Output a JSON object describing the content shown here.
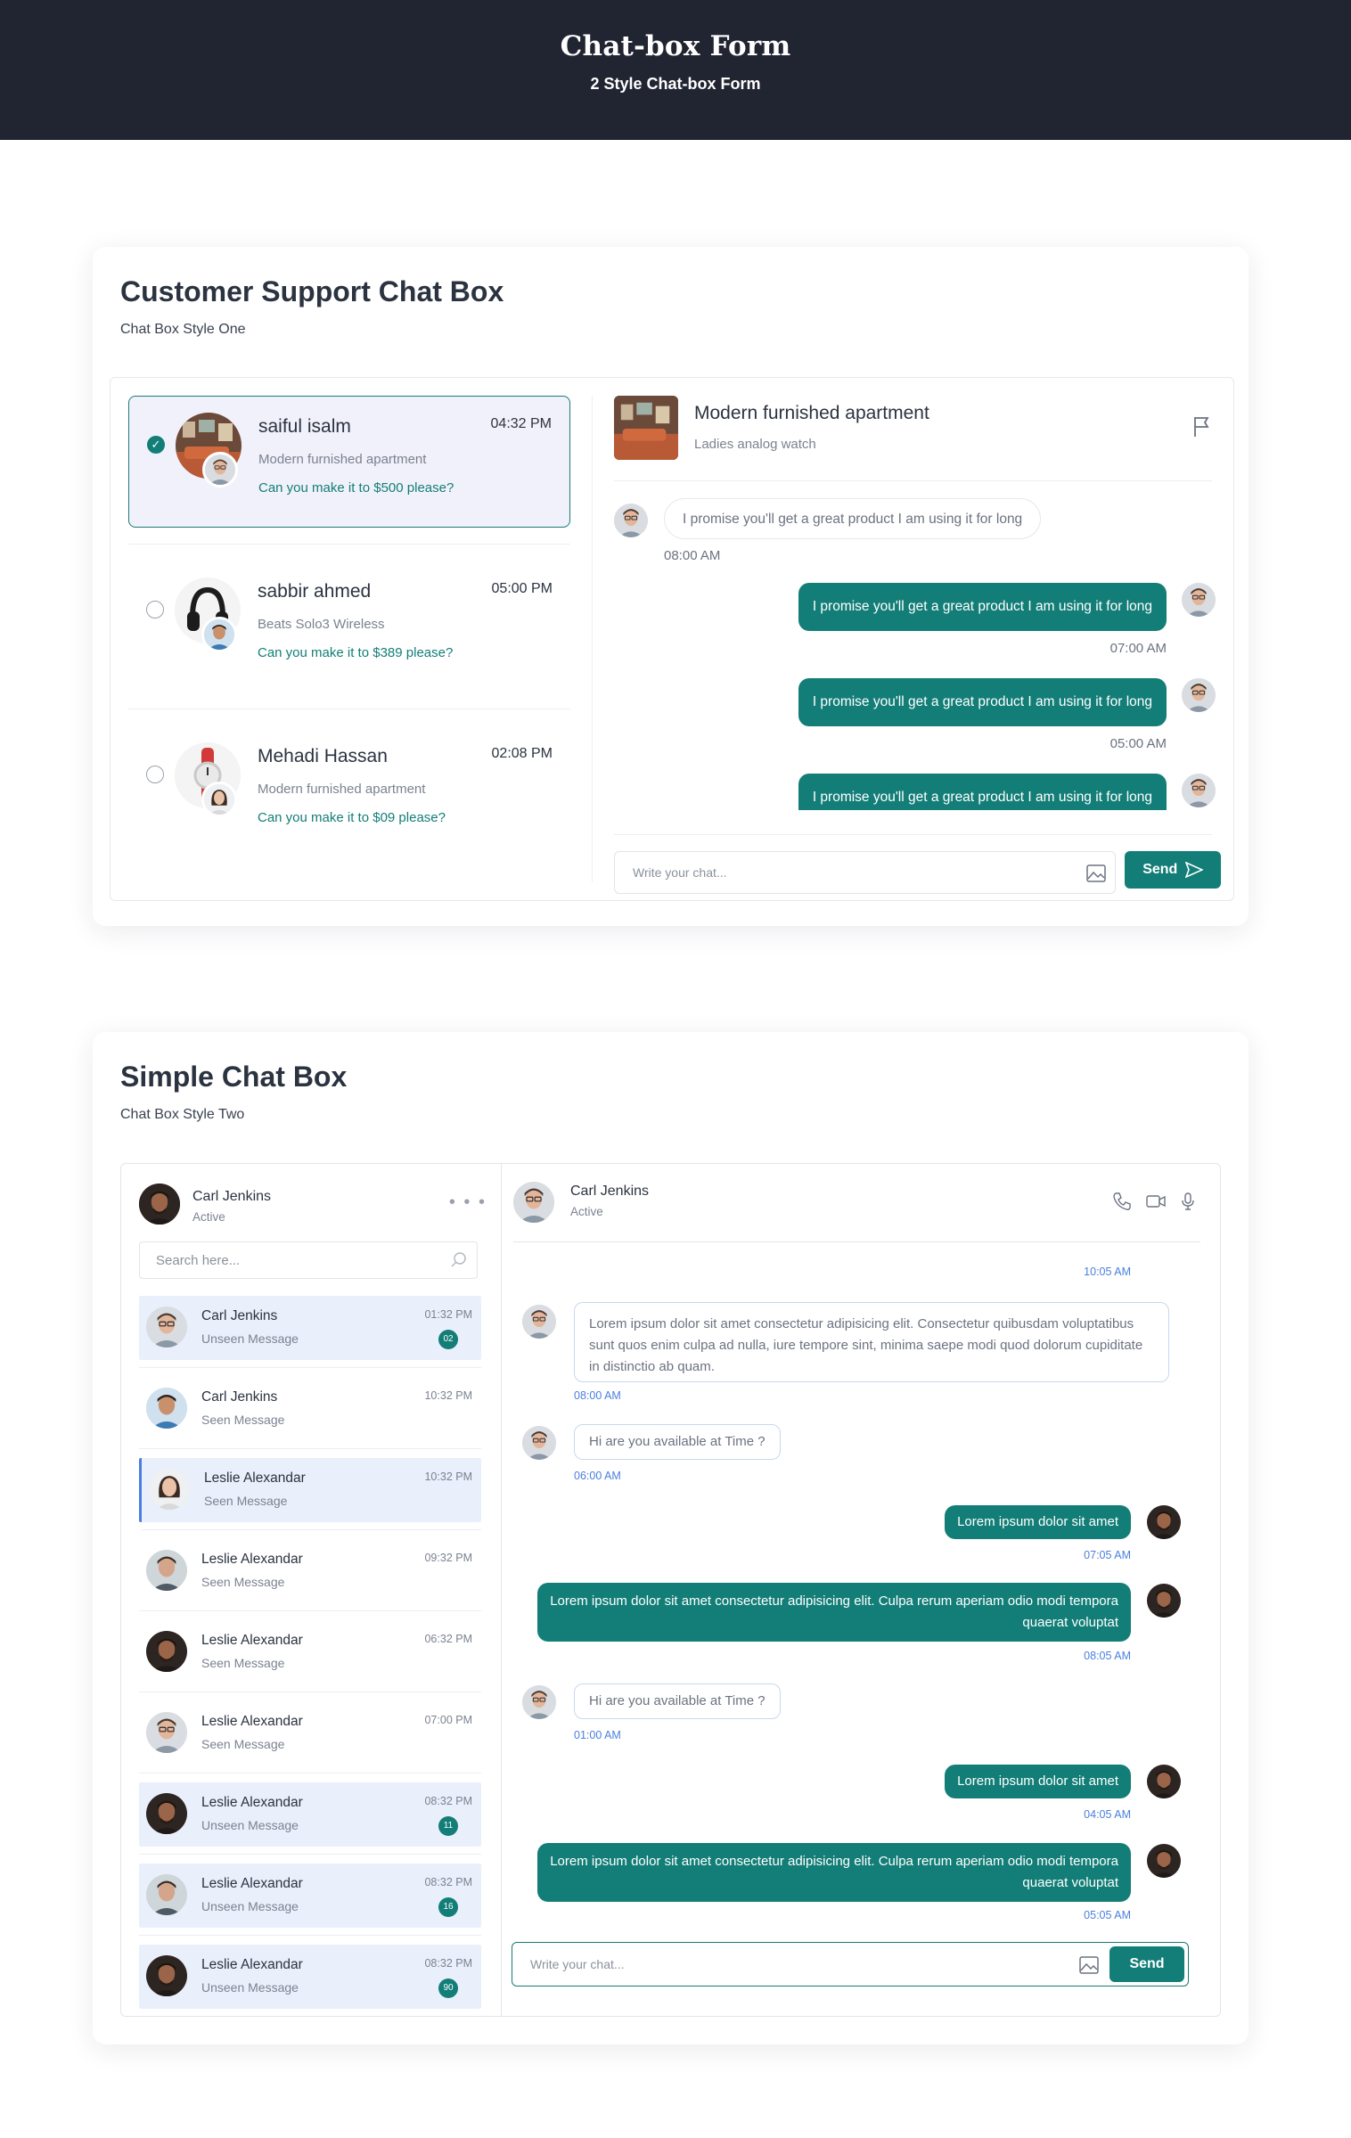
{
  "hero": {
    "title": "Chat-box Form",
    "subtitle": "2 Style Chat-box Form"
  },
  "section1": {
    "title": "Customer Support Chat Box",
    "subtitle": "Chat Box Style One",
    "contacts": [
      {
        "name": "saiful isalm",
        "time": "04:32 PM",
        "product": "Modern furnished apartment",
        "offer": "Can you make it to $500 please?",
        "selected": true
      },
      {
        "name": "sabbir ahmed",
        "time": "05:00 PM",
        "product": "Beats Solo3 Wireless",
        "offer": "Can you make it to $389 please?",
        "selected": false
      },
      {
        "name": "Mehadi Hassan",
        "time": "02:08 PM",
        "product": "Modern furnished apartment",
        "offer": "Can you make it to $09 please?",
        "selected": false
      }
    ],
    "chat": {
      "title": "Modern furnished apartment",
      "subtitle": "Ladies analog watch",
      "messages": [
        {
          "dir": "in",
          "text": "I promise you'll get a great product I am using it for long",
          "time": "08:00 AM"
        },
        {
          "dir": "out",
          "text": "I promise you'll get a great product I am using it for long",
          "time": "07:00 AM"
        },
        {
          "dir": "out",
          "text": "I promise you'll get a great product I am using it for long",
          "time": "05:00 AM"
        },
        {
          "dir": "out",
          "text": "I promise you'll get a great product I am using it for long",
          "time": ""
        }
      ],
      "input_placeholder": "Write your chat...",
      "send_label": "Send"
    }
  },
  "section2": {
    "title": "Simple Chat Box",
    "subtitle": "Chat Box Style Two",
    "me": {
      "name": "Carl Jenkins",
      "status": "Active"
    },
    "search_placeholder": "Search here...",
    "list": [
      {
        "name": "Carl Jenkins",
        "status": "Unseen Message",
        "time": "01:32 PM",
        "badge": "02",
        "state": "unread"
      },
      {
        "name": "Carl Jenkins",
        "status": "Seen Message",
        "time": "10:32 PM",
        "badge": "",
        "state": ""
      },
      {
        "name": "Leslie Alexandar",
        "status": "Seen Message",
        "time": "10:32 PM",
        "badge": "",
        "state": "sel"
      },
      {
        "name": "Leslie Alexandar",
        "status": "Seen Message",
        "time": "09:32 PM",
        "badge": "",
        "state": ""
      },
      {
        "name": "Leslie Alexandar",
        "status": "Seen Message",
        "time": "06:32 PM",
        "badge": "",
        "state": ""
      },
      {
        "name": "Leslie Alexandar",
        "status": "Seen Message",
        "time": "07:00 PM",
        "badge": "",
        "state": ""
      },
      {
        "name": "Leslie Alexandar",
        "status": "Unseen Message",
        "time": "08:32 PM",
        "badge": "11",
        "state": "unread"
      },
      {
        "name": "Leslie Alexandar",
        "status": "Unseen Message",
        "time": "08:32 PM",
        "badge": "16",
        "state": "unread"
      },
      {
        "name": "Leslie Alexandar",
        "status": "Unseen Message",
        "time": "08:32 PM",
        "badge": "90",
        "state": "unread"
      }
    ],
    "chat": {
      "name": "Carl Jenkins",
      "status": "Active",
      "top_time": "10:05 AM",
      "messages": [
        {
          "dir": "in",
          "text": "Lorem ipsum dolor sit amet consectetur adipisicing elit. Consectetur quibusdam voluptatibus sunt quos enim culpa ad nulla, iure tempore sint, minima saepe modi quod dolorum cupiditate in distinctio ab quam.",
          "time": "08:00 AM"
        },
        {
          "dir": "in",
          "text": "Hi are you available at Time ?",
          "time": "06:00 AM"
        },
        {
          "dir": "out",
          "text": "Lorem ipsum dolor sit amet",
          "time": "07:05 AM"
        },
        {
          "dir": "out",
          "text": "Lorem ipsum dolor sit amet consectetur adipisicing elit. Culpa rerum aperiam odio modi tempora quaerat voluptat",
          "time": "08:05 AM"
        },
        {
          "dir": "in",
          "text": "Hi are you available at Time ?",
          "time": "01:00 AM"
        },
        {
          "dir": "out",
          "text": "Lorem ipsum dolor sit amet",
          "time": "04:05 AM"
        },
        {
          "dir": "out",
          "text": "Lorem ipsum dolor sit amet consectetur adipisicing elit. Culpa rerum aperiam odio modi tempora quaerat voluptat",
          "time": "05:05 AM"
        }
      ],
      "input_placeholder": "Write your chat...",
      "send_label": "Send"
    }
  },
  "colors": {
    "accent": "#137e77",
    "hero_bg": "#212532",
    "link_time": "#4a7fe0",
    "unread_bg": "#eaf0fb"
  }
}
